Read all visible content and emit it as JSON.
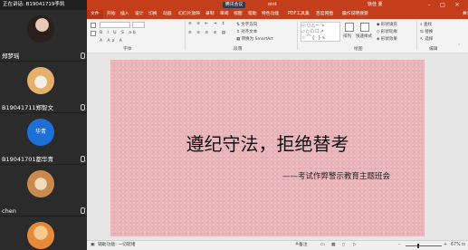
{
  "meeting": {
    "speaking_label": "正在讲话: B19041719李凯",
    "participants": [
      {
        "name": "郑梦瑶"
      },
      {
        "name": "B19041711郑智文"
      },
      {
        "name": "B19041701都华青",
        "avatar_text": "华青"
      },
      {
        "name": "chen"
      },
      {
        "name": ""
      }
    ]
  },
  "ppt": {
    "window_title": "演示文稿",
    "recording_badge": "腾讯会议",
    "title_suffix": "oint",
    "user": "徐佳 夏",
    "tabs": [
      "文件",
      "开始",
      "插入",
      "设计",
      "切换",
      "动画",
      "幻灯片放映",
      "录制",
      "审阅",
      "视图",
      "帮助",
      "特色功能",
      "PDF工具集",
      "百度网盘",
      "操作说明搜索"
    ],
    "share_label": "共享",
    "ribbon_groups": [
      "字体",
      "段落",
      "绘图",
      "编辑"
    ],
    "ribbon_small": {
      "text_direction": "文字方向",
      "align_text": "对齐文本",
      "smartart": "转换为 SmartArt",
      "arrange": "排列",
      "quick_styles": "快速样式",
      "shape_fill": "形状填充",
      "shape_outline": "形状轮廓",
      "shape_effects": "形状效果",
      "find": "查找",
      "replace": "替换",
      "select": "选择"
    },
    "slide": {
      "title": "遵纪守法，拒绝替考",
      "subtitle": "——考试作弊警示教育主题班会"
    },
    "status": {
      "accessibility": "辅助功能: 一切就绪",
      "notes": "备注",
      "zoom": "67%",
      "zoom_fraction": 0.67
    }
  },
  "colors": {
    "accent": "#c43e1c",
    "slide_bg": "#e8b4b8",
    "avatar_blue": "#1e6ed8"
  }
}
